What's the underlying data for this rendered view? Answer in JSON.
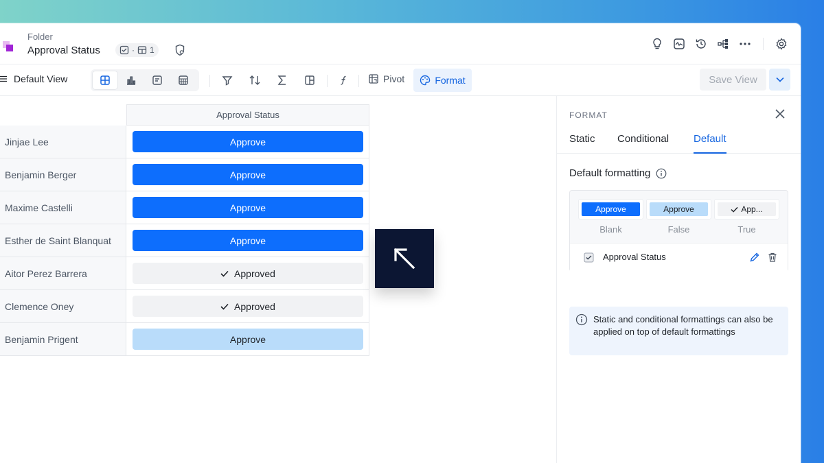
{
  "header": {
    "breadcrumb": "Folder",
    "title": "Approval Status",
    "badge_count": "1"
  },
  "toolbar": {
    "view_name": "Default View",
    "pivot_label": "Pivot",
    "format_label": "Format",
    "save_view_label": "Save View"
  },
  "table": {
    "column_header": "Approval Status",
    "rows": [
      {
        "name": "Jinjae Lee",
        "value": "Approve",
        "style": "blue"
      },
      {
        "name": "Benjamin Berger",
        "value": "Approve",
        "style": "blue"
      },
      {
        "name": "Maxime Castelli",
        "value": "Approve",
        "style": "blue"
      },
      {
        "name": "Esther de Saint Blanquat",
        "value": "Approve",
        "style": "blue"
      },
      {
        "name": "Aitor Perez Barrera",
        "value": "Approved",
        "style": "grey"
      },
      {
        "name": "Clemence Oney",
        "value": "Approved",
        "style": "grey"
      },
      {
        "name": "Benjamin Prigent",
        "value": "Approve",
        "style": "light"
      }
    ]
  },
  "format_panel": {
    "title": "FORMAT",
    "tabs": [
      "Static",
      "Conditional",
      "Default"
    ],
    "active_tab": "Default",
    "section_title": "Default formatting",
    "samples": [
      {
        "chip": "Approve",
        "label": "Blank"
      },
      {
        "chip": "Approve",
        "label": "False"
      },
      {
        "chip": "App...",
        "label": "True"
      }
    ],
    "field_name": "Approval Status",
    "info_text": "Static and conditional formattings can also be applied on top of default formattings"
  },
  "colors": {
    "accent": "#1565e0",
    "approve_blue": "#0d6efd",
    "approve_light": "#b9dcfa",
    "approved_grey": "#f1f2f4",
    "cursor_overlay": "#0c1633"
  }
}
